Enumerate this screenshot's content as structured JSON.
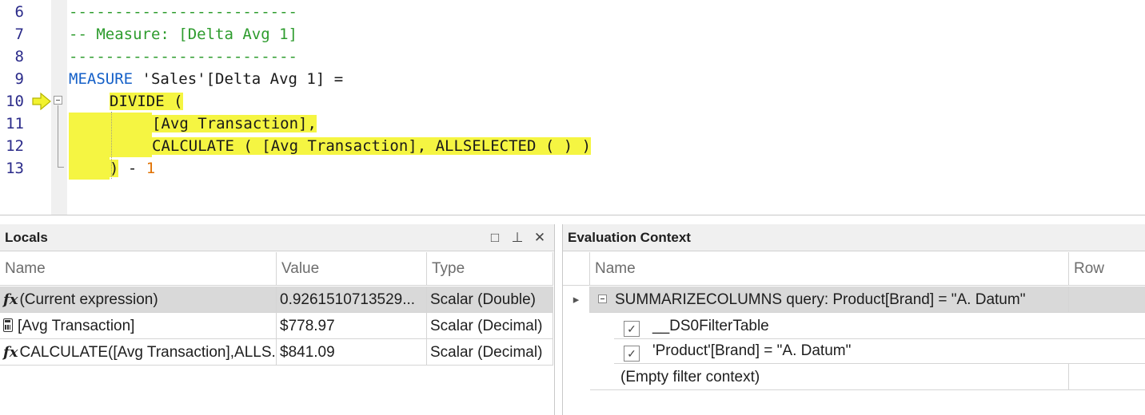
{
  "editor": {
    "line_numbers": [
      "6",
      "7",
      "8",
      "9",
      "10",
      "11",
      "12",
      "13"
    ],
    "lines": {
      "l6": "-------------------------",
      "l7": "-- Measure: [Delta Avg 1]",
      "l8": "-------------------------",
      "l9_kw": "MEASURE",
      "l9_rest": " 'Sales'[Delta Avg 1] =",
      "l10": "DIVIDE (",
      "l11": "[Avg Transaction],",
      "l12": "CALCULATE ( [Avg Transaction], ALLSELECTED ( ) )",
      "l13_hl": ")",
      "l13_op": " - ",
      "l13_num": "1"
    },
    "current_line_icon": "arrow-right-icon"
  },
  "locals": {
    "title": "Locals",
    "icons": [
      "maximize-icon",
      "pin-icon",
      "close-icon"
    ],
    "icon_glyphs": [
      "□",
      "⊥",
      "✕"
    ],
    "columns": {
      "name": "Name",
      "value": "Value",
      "type": "Type"
    },
    "rows": [
      {
        "icon": "fx-icon",
        "icon_text": "fx",
        "name": "(Current expression)",
        "value": "0.9261510713529...",
        "type": "Scalar (Double)"
      },
      {
        "icon": "calculator-icon",
        "name": "[Avg Transaction]",
        "value": "$778.97",
        "type": "Scalar (Decimal)"
      },
      {
        "icon": "fx-icon",
        "icon_text": "fx",
        "name": "CALCULATE([Avg Transaction],ALLS...",
        "value": "$841.09",
        "type": "Scalar (Decimal)"
      }
    ]
  },
  "evaluation": {
    "title": "Evaluation Context",
    "columns": {
      "name": "Name",
      "row": "Row"
    },
    "group": {
      "label": "SUMMARIZECOLUMNS query: Product[Brand] = \"A. Datum\""
    },
    "filters": [
      {
        "label": "__DS0FilterTable",
        "check": "✓"
      },
      {
        "label": "'Product'[Brand] = \"A. Datum\"",
        "check": "✓"
      }
    ],
    "empty_label": "(Empty filter context)",
    "expander_glyph": "▸"
  }
}
